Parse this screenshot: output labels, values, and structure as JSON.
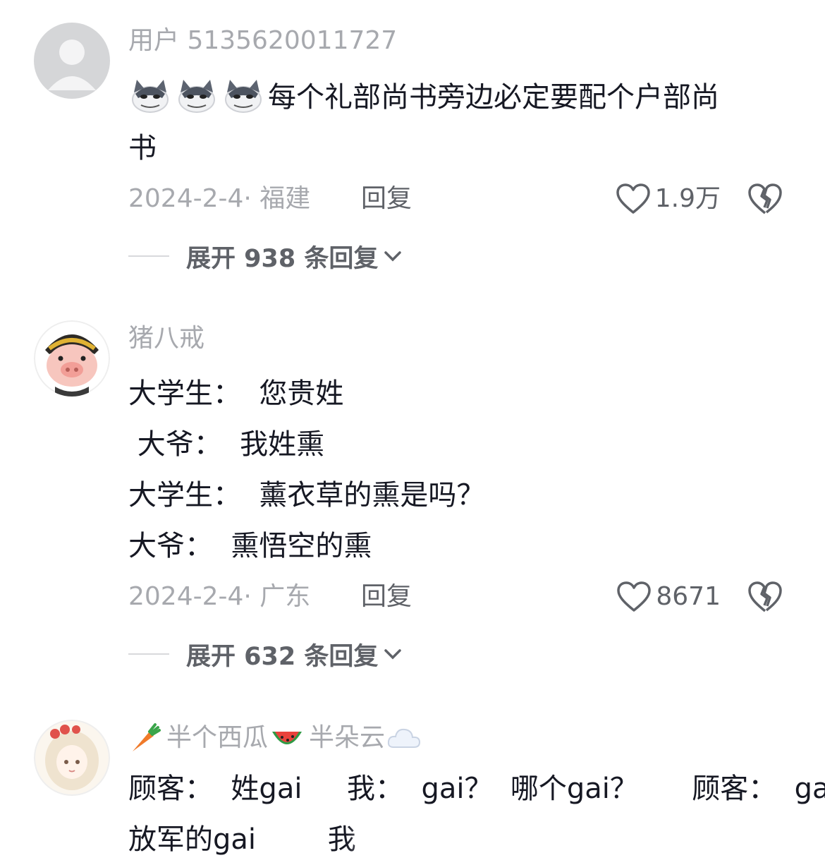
{
  "comments": [
    {
      "username": "用户 5135620011727",
      "lines": [
        "每个礼部尚书旁边必定要配个户部尚",
        "书"
      ],
      "emoji": [
        "wolf-emoji",
        "wolf-emoji",
        "wolf-emoji"
      ],
      "date_location": "2024-2-4· 福建",
      "reply_label": "回复",
      "likes": "1.9万",
      "expand_label": "展开 938 条回复"
    },
    {
      "username": "猪八戒",
      "lines": [
        "大学生：  您贵姓",
        " 大爷：  我姓熏",
        "大学生：  薰衣草的熏是吗？",
        "大爷：  熏悟空的熏"
      ],
      "date_location": "2024-2-4· 广东",
      "reply_label": "回复",
      "likes": "8671",
      "expand_label": "展开 632 条回复"
    },
    {
      "username_parts": [
        "半个西瓜",
        "半朵云"
      ],
      "lines": [
        "顾客：  姓gai     我：  gai？  哪个gai？      顾客：  gai",
        "放军的gai        我"
      ]
    }
  ],
  "colors": {
    "text": "#161823",
    "secondary": "#a7a9ae",
    "action": "#5f6268"
  },
  "icons": [
    "heart-icon",
    "broken-heart-icon",
    "chevron-down-icon",
    "carrot-icon",
    "watermelon-icon",
    "cloud-icon"
  ]
}
